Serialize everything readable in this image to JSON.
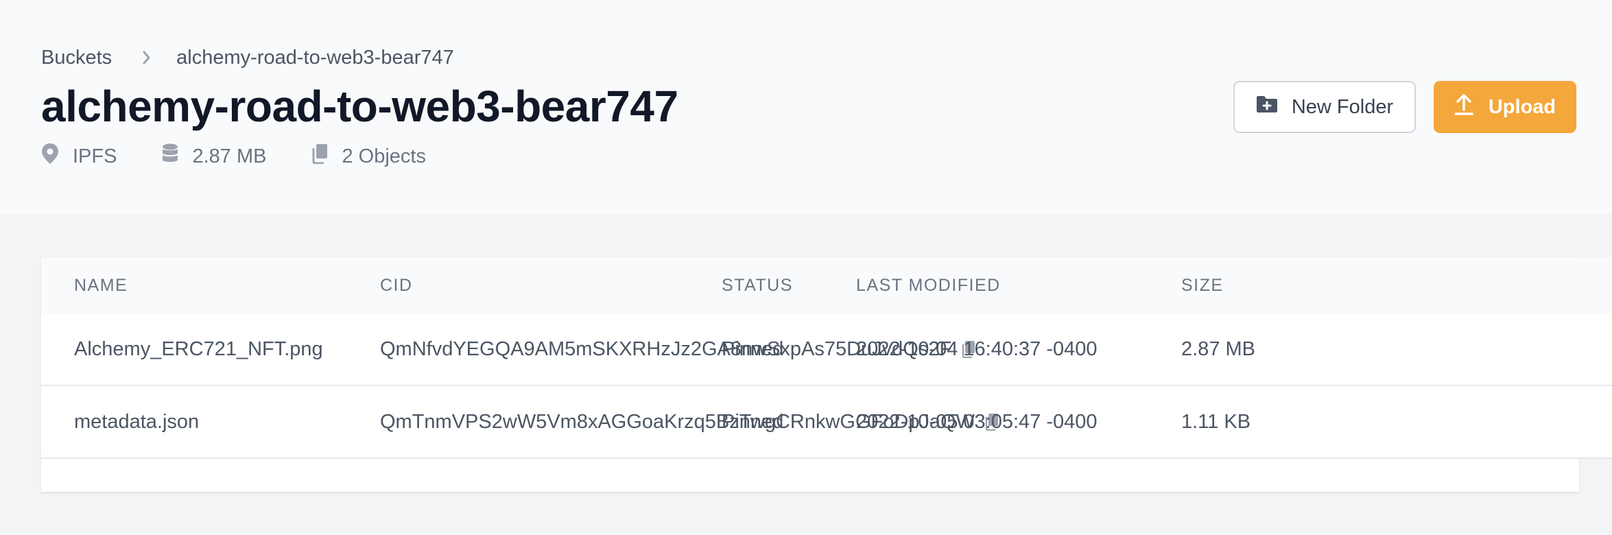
{
  "breadcrumb": {
    "root": "Buckets",
    "current": "alchemy-road-to-web3-bear747"
  },
  "page": {
    "title": "alchemy-road-to-web3-bear747"
  },
  "meta": {
    "location": "IPFS",
    "size": "2.87 MB",
    "objects": "2 Objects"
  },
  "actions": {
    "new_folder_label": "New Folder",
    "upload_label": "Upload"
  },
  "table": {
    "headers": {
      "name": "NAME",
      "cid": "CID",
      "status": "STATUS",
      "last_modified": "LAST MODIFIED",
      "size": "SIZE"
    },
    "rows": [
      {
        "name": "Alchemy_ERC721_NFT.png",
        "cid": "QmNfvdYEGQA9AM5mSKXRHzJz2GA8nwSxpAs75DuJvdQs2F",
        "status": "Pinned",
        "last_modified": "2022-10-04 16:40:37 -0400",
        "size": "2.87 MB"
      },
      {
        "name": "metadata.json",
        "cid": "QmTnmVPS2wW5Vm8xAGGoaKrzq5BzTwgCRnkwGGFoDpJaQW",
        "status": "Pinned",
        "last_modified": "2022-10-05 03:05:47 -0400",
        "size": "1.11 KB"
      }
    ]
  },
  "colors": {
    "accent": "#f4a73b",
    "page_bg": "#f3f4f6",
    "header_bg": "#f9fafb",
    "title": "#111827",
    "muted": "#6b7280"
  },
  "icons": {
    "breadcrumb_separator": "chevron-right-icon",
    "location": "map-pin-icon",
    "size": "database-icon",
    "objects": "copy-documents-icon",
    "new_folder": "folder-plus-icon",
    "upload": "upload-icon",
    "copy_cid": "clipboard-copy-icon"
  }
}
